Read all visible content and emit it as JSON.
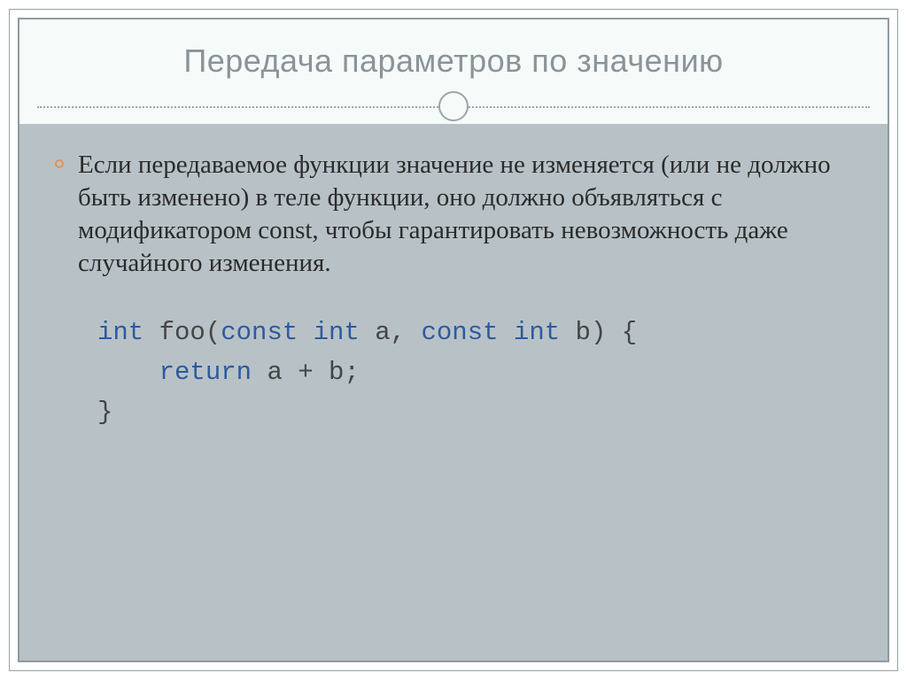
{
  "title": "Передача параметров по значению",
  "paragraph": "Если передаваемое функции значение не изменяется (или не должно быть изменено) в теле функции, оно должно объявляться с модификатором const, чтобы гарантировать невозможность даже случайного изменения.",
  "code": {
    "kw_int1": "int",
    "fn_open": " foo(",
    "kw_const1": "const",
    "sp1": " ",
    "kw_int2": "int",
    "param_a": " a, ",
    "kw_const2": "const",
    "sp2": " ",
    "kw_int3": "int",
    "param_b": " b) {",
    "indent_return": "    ",
    "kw_return": "return",
    "expr": " a + b;",
    "close_brace": "}"
  },
  "colors": {
    "keyword": "#2d5aa0",
    "accent_bullet": "#e0915a",
    "slide_bg": "#b8c2c6",
    "title_bg": "#f6faf9",
    "title_color": "#8a9498"
  }
}
